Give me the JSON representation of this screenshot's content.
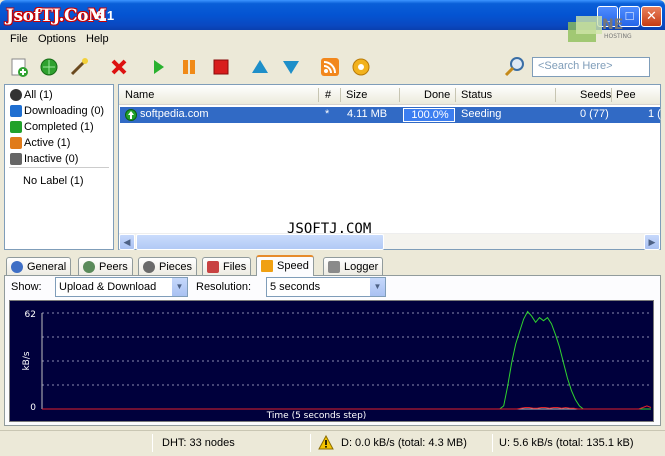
{
  "window": {
    "logo_text": "JsofTJ.CoM",
    "title_suffix": "6.1",
    "minimize": "_",
    "maximize": "□",
    "close": "✕"
  },
  "menu": [
    "File",
    "Options",
    "Help"
  ],
  "search": {
    "placeholder": "<Search Here>"
  },
  "sidebar": {
    "items": [
      {
        "label": "All (1)",
        "icon": "all-icon",
        "color": "#333333"
      },
      {
        "label": "Downloading (0)",
        "icon": "download-icon",
        "color": "#1f6fd1"
      },
      {
        "label": "Completed (1)",
        "icon": "completed-icon",
        "color": "#21a12a"
      },
      {
        "label": "Active (1)",
        "icon": "active-icon",
        "color": "#e07b1a"
      },
      {
        "label": "Inactive (0)",
        "icon": "inactive-icon",
        "color": "#666666"
      }
    ],
    "no_label": "No Label (1)"
  },
  "list": {
    "headers": {
      "name": "Name",
      "num": "#",
      "size": "Size",
      "done": "Done",
      "status": "Status",
      "seeds": "Seeds",
      "peers": "Pee"
    },
    "rows": [
      {
        "name": "softpedia.com",
        "num": "*",
        "size": "4.11 MB",
        "done": "100.0%",
        "done_fraction": 1.0,
        "status": "Seeding",
        "seeds": "0 (77)",
        "peers": "1 ("
      }
    ]
  },
  "watermark": "JSOFTJ.COM",
  "tabs": [
    {
      "label": "General",
      "icon": "info-icon",
      "active": false
    },
    {
      "label": "Peers",
      "icon": "peers-icon",
      "active": false
    },
    {
      "label": "Pieces",
      "icon": "pieces-icon",
      "active": false
    },
    {
      "label": "Files",
      "icon": "files-icon",
      "active": false
    },
    {
      "label": "Speed",
      "icon": "speed-icon",
      "active": true
    },
    {
      "label": "Logger",
      "icon": "logger-icon",
      "active": false
    }
  ],
  "speed_panel": {
    "show_label": "Show:",
    "show_value": "Upload & Download",
    "resolution_label": "Resolution:",
    "resolution_value": "5 seconds"
  },
  "chart_data": {
    "type": "line",
    "ylabel": "kB/s",
    "xlabel": "Time (5 seconds step)",
    "ylim": [
      0,
      62
    ],
    "yticks": [
      "62",
      "0"
    ],
    "grid": true,
    "series": [
      {
        "name": "upload",
        "color": "#2fd42f",
        "values": [
          0,
          0,
          0,
          0,
          0,
          0,
          0,
          0,
          0,
          0,
          0,
          0,
          0,
          0,
          0,
          0,
          0,
          0,
          0,
          0,
          0,
          0,
          0,
          0,
          0,
          0,
          0,
          0,
          0,
          0,
          0,
          0,
          0,
          0,
          0,
          0,
          0,
          0,
          0,
          0,
          0,
          0,
          0,
          0,
          0,
          0,
          0,
          0,
          0,
          0,
          0,
          0,
          0,
          0,
          0,
          0,
          0,
          0,
          0,
          0,
          0,
          0,
          0,
          0,
          0,
          0,
          0,
          0,
          0,
          0,
          0,
          0,
          0,
          0,
          0,
          0,
          0,
          0,
          0,
          0,
          0,
          0,
          0,
          0,
          0,
          0,
          0,
          0,
          0,
          0,
          0,
          0,
          0,
          0,
          0,
          0,
          0,
          0,
          0,
          0,
          0,
          0,
          0,
          0,
          0,
          0,
          0,
          0,
          0,
          0,
          0,
          0,
          0,
          0,
          0,
          0,
          2,
          15,
          30,
          42,
          50,
          58,
          63,
          60,
          56,
          59,
          57,
          59,
          55,
          48,
          40,
          30,
          20,
          12,
          6,
          2,
          0,
          0,
          0,
          0,
          0,
          0,
          0,
          0,
          0,
          0,
          0,
          0,
          0,
          0,
          0,
          0,
          0,
          0
        ]
      },
      {
        "name": "download",
        "color": "#e0202a",
        "values": [
          0,
          0,
          0,
          0,
          0,
          0,
          0,
          0,
          0,
          0,
          0,
          0,
          0,
          0,
          0,
          0,
          0,
          0,
          0,
          0,
          0,
          0,
          0,
          0,
          0,
          0,
          0,
          0,
          0,
          0,
          0,
          0,
          0,
          0,
          0,
          0,
          0,
          0,
          0,
          0,
          0,
          0,
          0,
          0,
          0,
          0,
          0,
          0,
          0,
          0,
          0,
          0,
          0,
          0,
          0,
          0,
          0,
          0,
          0,
          0,
          0,
          0,
          0,
          0,
          0,
          0,
          0,
          0,
          0,
          0,
          0,
          0,
          0,
          0,
          0,
          0,
          0,
          0,
          0,
          0,
          0,
          0,
          0,
          0,
          0,
          0,
          0,
          0,
          0,
          0,
          0,
          0,
          0,
          0,
          0,
          0,
          0,
          0,
          0,
          0,
          0,
          0,
          0,
          0,
          0,
          0,
          0,
          0,
          0,
          0,
          0,
          0,
          0,
          0,
          0,
          0,
          0,
          0,
          0.5,
          1,
          1,
          0.5,
          0.5,
          1,
          1,
          0.5,
          1,
          1,
          0.5,
          1,
          0.5,
          0.5,
          0,
          0,
          0,
          0,
          0,
          0,
          0,
          0,
          0,
          0,
          0,
          0,
          0,
          0,
          0,
          0,
          1,
          2,
          1
        ]
      }
    ]
  },
  "status": {
    "dht": "DHT: 33 nodes",
    "down": "D: 0.0 kB/s (total: 4.3 MB)",
    "up": "U: 5.6 kB/s (total: 135.1 kB)"
  }
}
